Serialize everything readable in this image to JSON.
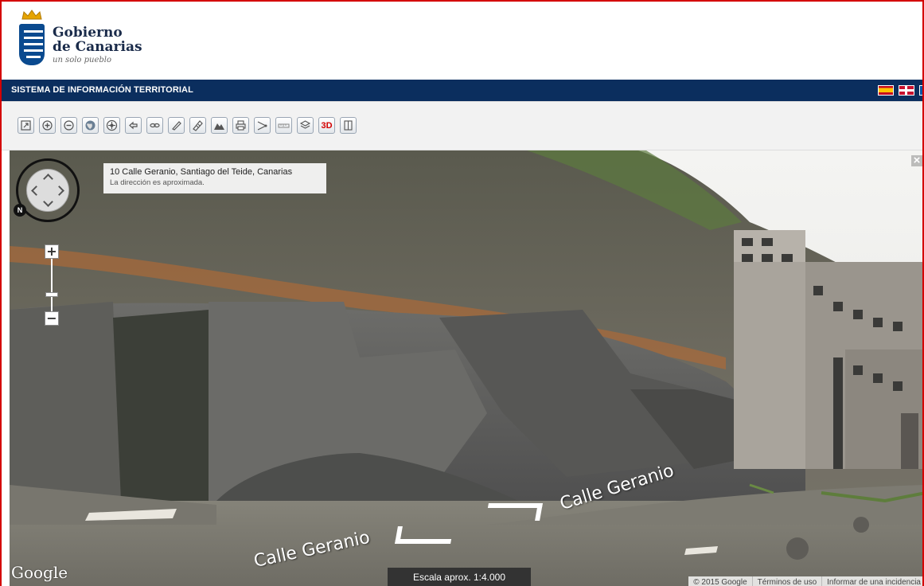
{
  "header": {
    "logo_line1": "Gobierno",
    "logo_line2": "de Canarias",
    "logo_tagline": "un solo pueblo"
  },
  "titlebar": {
    "title": "SISTEMA DE INFORMACIÓN TERRITORIAL",
    "languages": [
      "es-flag",
      "en-flag",
      "fr-flag"
    ]
  },
  "toolbar": {
    "tools": [
      {
        "name": "full-extent-icon"
      },
      {
        "name": "zoom-in-icon"
      },
      {
        "name": "zoom-out-icon"
      },
      {
        "name": "globe-icon"
      },
      {
        "name": "pan-icon"
      },
      {
        "name": "back-icon"
      },
      {
        "name": "link-icon"
      },
      {
        "name": "measure-line-icon"
      },
      {
        "name": "measure-area-icon"
      },
      {
        "name": "profile-icon"
      },
      {
        "name": "print-icon"
      },
      {
        "name": "route-icon"
      },
      {
        "name": "scale-icon"
      },
      {
        "name": "layers-icon"
      },
      {
        "name": "3d-button",
        "label": "3D"
      },
      {
        "name": "book-icon"
      }
    ]
  },
  "streetview": {
    "address": "10 Calle Geranio, Santiago del Teide, Canarias",
    "address_note": "La dirección es aproximada.",
    "compass_label": "N",
    "street_label": "Calle Geranio",
    "google_logo": "Google",
    "scale": "Escala aprox. 1:4.000",
    "attribution": [
      "© 2015 Google",
      "Términos de uso",
      "Informar de una incidencia"
    ],
    "close": "×"
  },
  "colors": {
    "frame_border": "#d40000",
    "titlebar_bg": "#0b2e5e",
    "toolbar_bg": "#f2f2f2",
    "accent_3d": "#d40000"
  }
}
